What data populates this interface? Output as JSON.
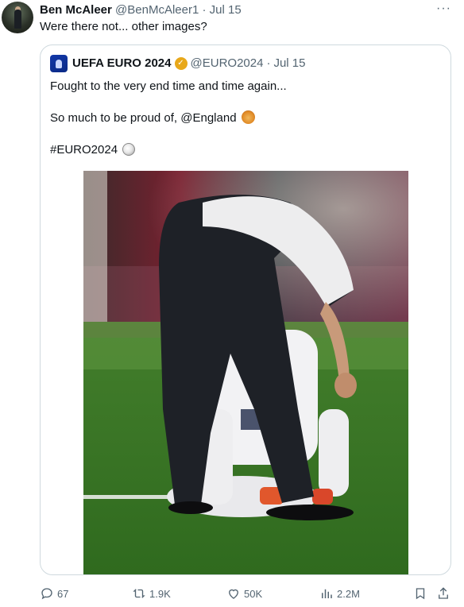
{
  "tweet": {
    "display_name": "Ben McAleer",
    "handle": "@BenMcAleer1",
    "separator": "·",
    "date": "Jul 15",
    "text": "Were there not... other images?",
    "more_icon": "more-horizontal-icon"
  },
  "quote": {
    "display_name": "UEFA EURO 2024",
    "verified_color": "#e8a81a",
    "handle": "@EURO2024",
    "separator": "·",
    "date": "Jul 15",
    "line1": "Fought to the very end time and time again...",
    "line2": "So much to be proud of, @England",
    "line3": "#EURO2024",
    "media_description_icon": "photo"
  },
  "actions": {
    "replies": "67",
    "reposts": "1.9K",
    "likes": "50K",
    "views": "2.2M"
  },
  "colors": {
    "text": "#0f1419",
    "muted": "#536471",
    "border": "#cfd9de"
  }
}
